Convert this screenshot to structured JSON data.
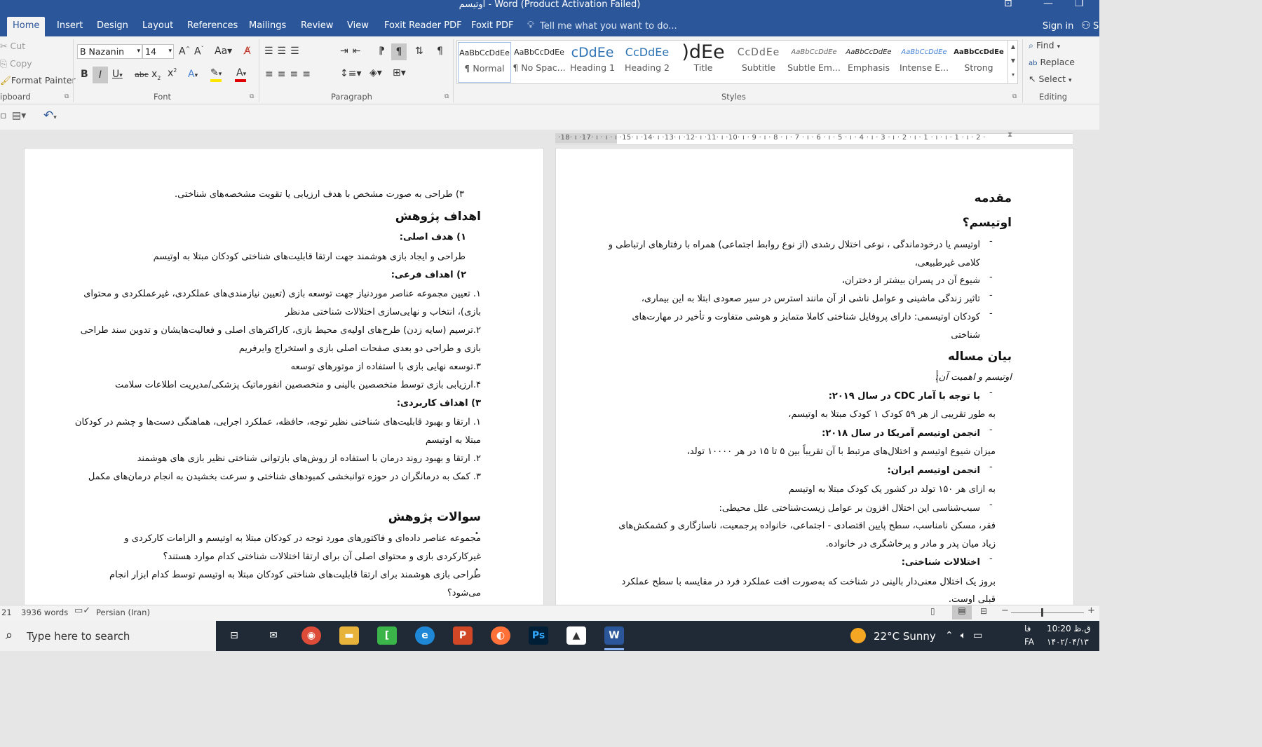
{
  "window": {
    "title": "اوتیسم - Word (Product Activation Failed)",
    "controls": [
      "⊡",
      "—",
      "❐"
    ]
  },
  "tabs": [
    "Home",
    "Insert",
    "Design",
    "Layout",
    "References",
    "Mailings",
    "Review",
    "View",
    "Foxit Reader PDF",
    "Foxit PDF"
  ],
  "tell_me": "Tell me what you want to do...",
  "account": {
    "sign_in": "Sign in",
    "share": "S"
  },
  "clipboard": {
    "cut": "Cut",
    "copy": "Copy",
    "format_painter": "Format Painter",
    "label": "ipboard"
  },
  "font": {
    "name": "B Nazanin",
    "size": "14",
    "label": "Font"
  },
  "paragraph": {
    "label": "Paragraph"
  },
  "styles": {
    "label": "Styles",
    "items": [
      {
        "preview": "AaBbCcDdEe",
        "label": "¶ Normal"
      },
      {
        "preview": "AaBbCcDdEe",
        "label": "¶ No Spac..."
      },
      {
        "preview": "cDdEe",
        "label": "Heading 1"
      },
      {
        "preview": "CcDdEe",
        "label": "Heading 2"
      },
      {
        "preview": ")dEe",
        "label": "Title"
      },
      {
        "preview": "CcDdEe",
        "label": "Subtitle"
      },
      {
        "preview": "AaBbCcDdEe",
        "label": "Subtle Em..."
      },
      {
        "preview": "AaBbCcDdEe",
        "label": "Emphasis"
      },
      {
        "preview": "AaBbCcDdEe",
        "label": "Intense E..."
      },
      {
        "preview": "AaBbCcDdEe",
        "label": "Strong"
      }
    ]
  },
  "editing": {
    "find": "Find",
    "replace": "Replace",
    "select": "Select",
    "label": "Editing"
  },
  "ruler": {
    "labels": "·18· ı ·17· ı ·  ı · ı ·15· ı ·14· ı ·13· ı ·12· ı ·11· ı ·10· ı · 9 · ı · 8 · ı · 7 · ı · 6 · ı · 5 · ı · 4 · ı · 3 · ı · 2 · ı · 1 · ı ·  ı · 1 · ı · 2 ·"
  },
  "right_page": {
    "h_intro": "مقدمه",
    "h_autism": "اوتیسم؟",
    "b1_l1": "اوتیسم یا درخودماندگی ، نوعی اختلال رشدی (از نوع روابط اجتماعی) همراه با رفتارهای ارتباطی و",
    "b1_l2": "کلامی غیرطبیعی،",
    "b2": "شیوع آن در پسران بیشتر از دختران،",
    "b3": "تاثیر زندگی ماشینی و عوامل ناشی از آن مانند استرس در سیر صعودی ابتلا به این بیماری،",
    "b4_l1": "کودکان اوتیسمی: دارای پروفایل شناختی کاملا متمایز و هوشی متفاوت و تأخیر در مهارت‌های",
    "b4_l2": "شناختی",
    "h_problem": "بیان مساله",
    "italic": "اوتیسم و اهمیت آن:",
    "cdc": "با توجه با آمار  CDC در سال ۲۰۱۹:",
    "cdc_text": "به طور تقریبی از هر ۵۹ کودک ۱ کودک مبتلا به اوتیسم،",
    "usa": "انجمن اوتیسم آمریکا در سال ۲۰۱۸:",
    "usa_text": "میزان شیوع اوتیسم و اختلال‌های مرتبط با آن تقریباً بین ۵ تا ۱۵ در هر ۱۰۰۰۰ تولد،",
    "iran": "انجمن اوتیسم ایران:",
    "iran_text": "به ازای هر ۱۵۰ تولد در کشور یک کودک مبتلا به اوتیسم",
    "cause": "سبب‌شناسی این اختلال افزون بر عوامل زیست‌شناختی علل محیطی:",
    "cause_l1": "فقر، مسکن نامناسب، سطح پایین اقتصادی - اجتماعی، خانواده پرجمعیت، ناسازگاری و کشمکش‌های",
    "cause_l2": "زیاد میان پدر و مادر و پرخاشگری در خانواده.",
    "cog": "اختلالات شناختی:",
    "n1_l1": "بروز یک اختلال معنی‌دار بالینی در شناخت که به‌صورت افت عملکرد فرد در مقایسه با سطح عملکرد",
    "n1_l2": "قبلی اوست."
  },
  "left_page": {
    "p0": "۳) طراحی به صورت مشخص با هدف ارزیابی یا تقویت مشخصه‌های شناختی.",
    "h_goals": "اهداف پژوهش",
    "g1": "۱)  هدف اصلی:",
    "g1_text": "طراحی و ایجاد بازی هوشمند جهت ارتقا قابلیت‌های شناختی کودکان مبتلا به اوتیسم",
    "g2": "۲)  اهداف فرعی:",
    "s1_l1": "۱. تعیین مجموعه عناصر موردنیاز جهت توسعه بازی (تعیین نیازمندی‌های عملکردی، غیرعملکردی و محتوای",
    "s1_l2": "بازی)، انتخاب و نهایی‌سازی اختلالات شناختی مدنظر",
    "s2_l1": "۲.ترسیم (سایه زدن) طرح‌های اولیه‌ی محیط بازی، کاراکترهای اصلی و فعالیت‌هایشان و تدوین سند طراحی",
    "s2_l2": "بازی  و طراحی دو بعدی صفحات اصلی بازی و استخراج وایرفریم",
    "s3": "۳.توسعه نهایی بازی با استفاده از موتورهای توسعه",
    "s4": "۴.ارزیابی بازی توسط متخصصین بالینی و متخصصین انفورماتیک پزشکی/مدیریت اطلاعات سلامت",
    "g3": "۳) اهداف کاربردی:",
    "a1_l1": "۱. ارتقا و بهبود قابلیت‌های شناختی نظیر توجه، حافظه، عملکرد اجرایی، هماهنگی دست‌ها و چشم در کودکان",
    "a1_l2": "مبتلا به اوتیسم",
    "a2": "۲. ارتقا و بهبود روند درمان با استفاده از روش‌های بازتوانی شناختی نظیر بازی های هوشمند",
    "a3": "۳. کمک به درمانگران در حوزه توانبخشی کمبودهای شناختی و سرعت بخشیدن به انجام درمان‌های مکمل",
    "h_questions": "سوالات پژوهش",
    "q1_l1": "مجموعه عناصر داده‌ای و فاکتورهای مورد توجه در کودکان مبتلا به اوتیسم و الزامات کارکردی و",
    "q1_l2": "غیرکارکردی بازی و محتوای اصلی آن برای ارتقا اختلالات شناختی کدام موارد هستند؟",
    "q2_l1": "طراحی بازی هوشمند برای ارتقا قابلیت‌های شناختی کودکان مبتلا به اوتیسم توسط کدام ابزار انجام",
    "q2_l2": "می‌شود؟"
  },
  "status": {
    "page": "21",
    "words": "3936 words",
    "language": "Persian (Iran)"
  },
  "taskbar": {
    "search_placeholder": "Type here to search",
    "weather": "22°C  Sunny",
    "lang_short": "فا",
    "lang": "FA",
    "time": "10:20 ق.ظ",
    "date": "۱۴۰۲/۰۴/۱۳"
  },
  "colors": {
    "word_blue": "#2b579a",
    "taskbar": "#1f2a36"
  }
}
